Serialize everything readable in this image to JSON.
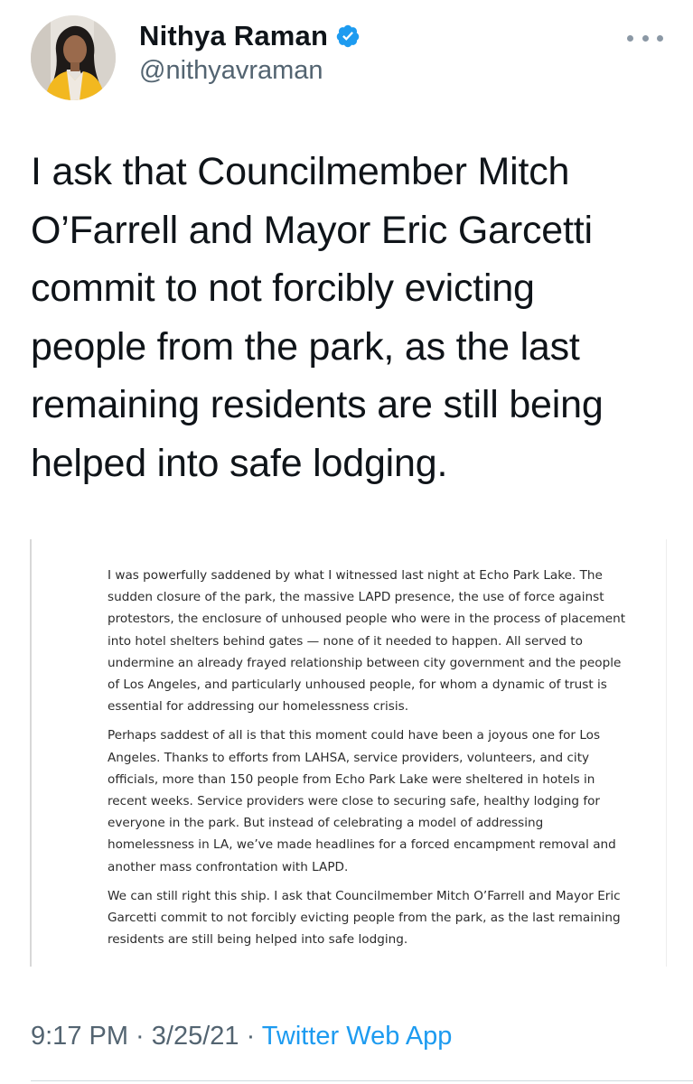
{
  "author": {
    "display_name": "Nithya Raman",
    "handle": "@nithyavraman",
    "verified_icon": "verified-badge-icon"
  },
  "tweet": {
    "text_lines": [
      "I ask that Councilmember Mitch",
      "O’Farrell and Mayor Eric Garcetti",
      "commit to not forcibly evicting",
      "people from the park, as the last",
      "remaining residents are still being",
      "helped into safe lodging."
    ]
  },
  "statement": {
    "paragraphs": [
      [
        "I was powerfully saddened by what I witnessed last night at Echo Park Lake. The",
        "sudden closure of the park, the massive LAPD presence,  the use of force against",
        "protestors, the enclosure of unhoused people who were in the process of placement",
        "into hotel shelters behind gates — none of it needed   to happen. All served to",
        "undermine an already frayed relationship between city government and the people",
        "of Los Angeles, and particularly unhoused people, for whom a dynamic of trust is",
        "essential for addressing our homelessness crisis."
      ],
      [
        "Perhaps saddest of all is that this moment could have been a joyous one for Los",
        "Angeles. Thanks to efforts from LAHSA, service providers, volunteers, and city",
        "officials, more than 150 people from Echo Park Lake were sheltered in hotels in",
        "recent weeks. Service providers were close to securing safe, healthy lodging for",
        "everyone in the park. But instead of celebrating a model of addressing",
        "homelessness in LA, we’ve made headlines for a forced encampment removal and",
        "another mass confrontation with LAPD."
      ],
      [
        "We can still right this ship. I ask that Councilmember Mitch O’Farrell and Mayor Eric",
        "Garcetti commit to not forcibly evicting people from the park, as the last remaining",
        "residents are still being helped into safe lodging."
      ]
    ]
  },
  "meta": {
    "time": "9:17 PM",
    "separator": " · ",
    "date": "3/25/21",
    "source": "Twitter Web App"
  },
  "colors": {
    "accent": "#1d9bf0",
    "muted": "#536471",
    "text": "#0f1419"
  }
}
